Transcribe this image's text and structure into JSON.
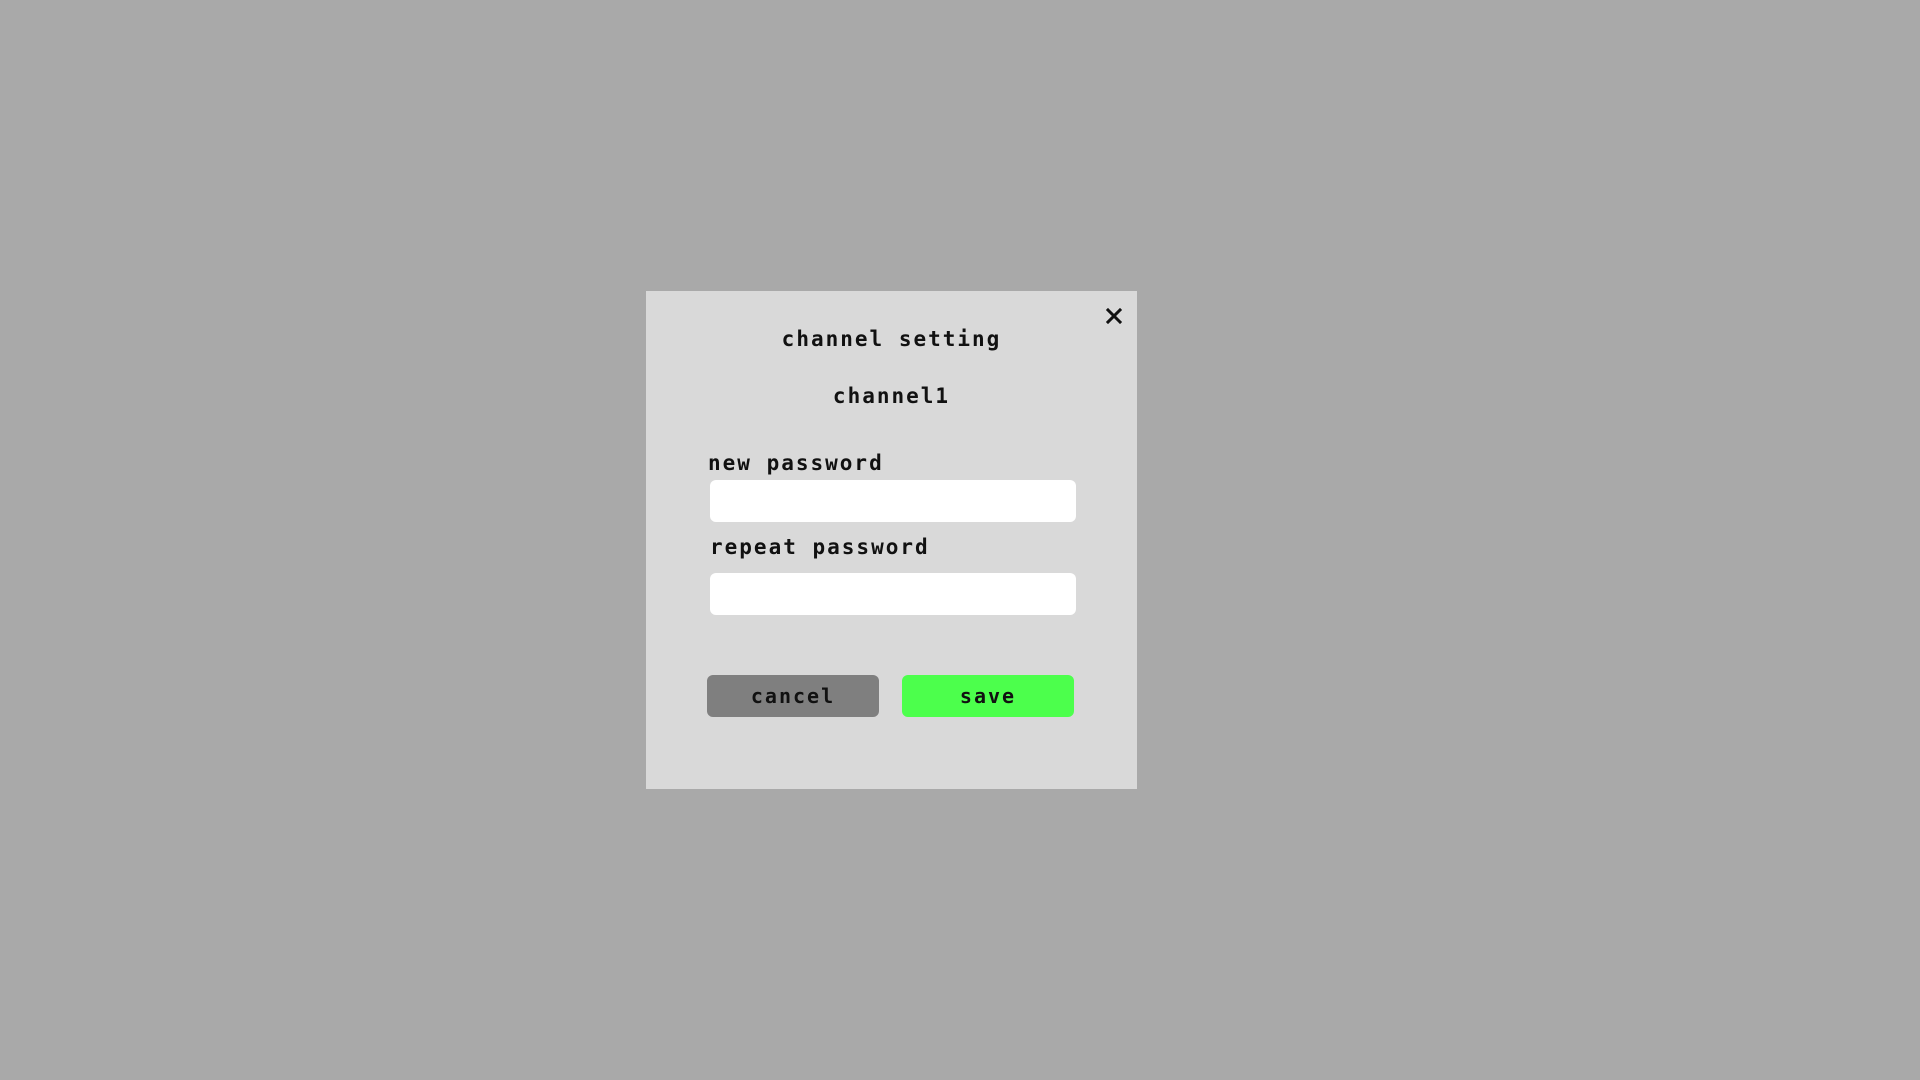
{
  "dialog": {
    "title": "channel setting",
    "channel_name": "channel1",
    "close_icon": "close-icon",
    "new_password": {
      "label": "new password",
      "value": "",
      "placeholder": ""
    },
    "repeat_password": {
      "label": "repeat password",
      "value": "",
      "placeholder": ""
    },
    "cancel_label": "cancel",
    "save_label": "save"
  },
  "colors": {
    "backdrop": "#a9a9a9",
    "panel": "#d9d9d9",
    "cancel_button": "#7f7f7f",
    "save_button": "#4cff4c"
  }
}
